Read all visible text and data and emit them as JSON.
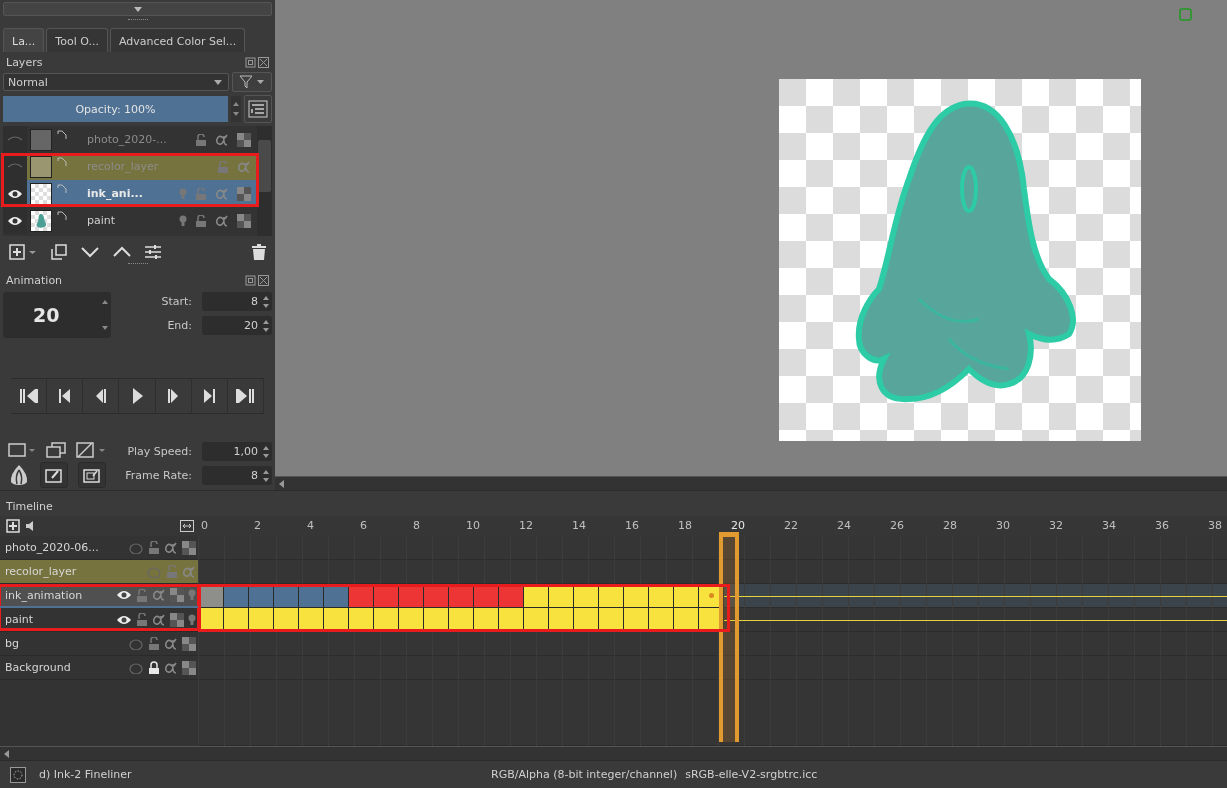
{
  "tabs": [
    {
      "label": "La...",
      "selected": true
    },
    {
      "label": "Tool O...",
      "selected": false
    },
    {
      "label": "Advanced Color Sel...",
      "selected": false
    }
  ],
  "layers_panel": {
    "title": "Layers",
    "blend_mode": "Normal",
    "opacity": {
      "label": "Opacity:  100%",
      "level": 1
    },
    "layers": [
      {
        "name": "photo_2020-...",
        "kind": "photo",
        "visible": false,
        "selected": false,
        "onion_skin": false,
        "annotated": false
      },
      {
        "name": "recolor_layer",
        "kind": "fill",
        "visible": false,
        "selected": false,
        "onion_skin": false,
        "annotated": true,
        "color": "#77733f"
      },
      {
        "name": "ink_ani...",
        "kind": "transparent",
        "visible": true,
        "selected": true,
        "onion_skin": true,
        "annotated": true
      },
      {
        "name": "paint",
        "kind": "figure",
        "visible": true,
        "selected": false,
        "onion_skin": true,
        "annotated": false
      }
    ]
  },
  "animation": {
    "title": "Animation",
    "current_frame": "20",
    "start_label": "Start:",
    "start": "8",
    "end_label": "End:",
    "end": "20",
    "play_speed_label": "Play Speed:",
    "play_speed": "1,00",
    "frame_rate_label": "Frame Rate:",
    "frame_rate": "8"
  },
  "timeline": {
    "title": "Timeline",
    "ruler": [
      {
        "label": "0",
        "selected": false
      },
      {
        "label": "2",
        "selected": false
      },
      {
        "label": "4",
        "selected": false
      },
      {
        "label": "6",
        "selected": false
      },
      {
        "label": "8",
        "selected": false
      },
      {
        "label": "10",
        "selected": false
      },
      {
        "label": "12",
        "selected": false
      },
      {
        "label": "14",
        "selected": false
      },
      {
        "label": "16",
        "selected": false
      },
      {
        "label": "18",
        "selected": false
      },
      {
        "label": "20",
        "selected": true
      },
      {
        "label": "22",
        "selected": false
      },
      {
        "label": "24",
        "selected": false
      },
      {
        "label": "26",
        "selected": false
      },
      {
        "label": "28",
        "selected": false
      },
      {
        "label": "30",
        "selected": false
      },
      {
        "label": "32",
        "selected": false
      },
      {
        "label": "34",
        "selected": false
      },
      {
        "label": "36",
        "selected": false
      },
      {
        "label": "38",
        "selected": false
      }
    ],
    "rows": [
      {
        "name": "photo_2020-06...",
        "visible": false,
        "locked": false,
        "onion_skin": false,
        "selected": false,
        "annotated": false,
        "frames": []
      },
      {
        "name": "recolor_layer",
        "visible": false,
        "locked": false,
        "onion_skin": false,
        "selected": false,
        "annotated": false,
        "color": "#77733f",
        "frames": []
      },
      {
        "name": "ink_animation",
        "visible": true,
        "locked": false,
        "onion_skin": true,
        "selected": true,
        "annotated": true,
        "frames": [
          {
            "color": "#8e8e8a",
            "selected": false
          },
          {
            "color": "#4f7194",
            "selected": false
          },
          {
            "color": "#4f7194",
            "selected": false
          },
          {
            "color": "#4f7194",
            "selected": false
          },
          {
            "color": "#4f7194",
            "selected": false
          },
          {
            "color": "#4f7194",
            "selected": false
          },
          {
            "color": "#ee3535",
            "selected": false
          },
          {
            "color": "#ee3535",
            "selected": false
          },
          {
            "color": "#ee3535",
            "selected": false
          },
          {
            "color": "#ee3535",
            "selected": false
          },
          {
            "color": "#ee3535",
            "selected": false
          },
          {
            "color": "#ee3535",
            "selected": false
          },
          {
            "color": "#ee3535",
            "selected": false
          },
          {
            "color": "#f7e23e",
            "selected": false
          },
          {
            "color": "#f7e23e",
            "selected": false
          },
          {
            "color": "#f7e23e",
            "selected": false
          },
          {
            "color": "#f7e23e",
            "selected": false
          },
          {
            "color": "#f7e23e",
            "selected": false
          },
          {
            "color": "#f7e23e",
            "selected": false
          },
          {
            "color": "#f7e23e",
            "selected": false
          },
          {
            "color": "#f7e23e",
            "selected": true
          }
        ]
      },
      {
        "name": "paint",
        "visible": true,
        "locked": false,
        "onion_skin": true,
        "selected": false,
        "annotated": true,
        "frames": [
          {
            "color": "#f7e23e",
            "selected": false
          },
          {
            "color": "#f7e23e",
            "selected": false
          },
          {
            "color": "#f7e23e",
            "selected": false
          },
          {
            "color": "#f7e23e",
            "selected": false
          },
          {
            "color": "#f7e23e",
            "selected": false
          },
          {
            "color": "#f7e23e",
            "selected": false
          },
          {
            "color": "#f7e23e",
            "selected": false
          },
          {
            "color": "#f7e23e",
            "selected": false
          },
          {
            "color": "#f7e23e",
            "selected": false
          },
          {
            "color": "#f7e23e",
            "selected": false
          },
          {
            "color": "#f7e23e",
            "selected": false
          },
          {
            "color": "#f7e23e",
            "selected": false
          },
          {
            "color": "#f7e23e",
            "selected": false
          },
          {
            "color": "#f7e23e",
            "selected": false
          },
          {
            "color": "#f7e23e",
            "selected": false
          },
          {
            "color": "#f7e23e",
            "selected": false
          },
          {
            "color": "#f7e23e",
            "selected": false
          },
          {
            "color": "#f7e23e",
            "selected": false
          },
          {
            "color": "#f7e23e",
            "selected": false
          },
          {
            "color": "#f7e23e",
            "selected": false
          },
          {
            "color": "#f7e23e",
            "selected": false
          }
        ]
      },
      {
        "name": "bg",
        "visible": false,
        "locked": false,
        "onion_skin": false,
        "selected": false,
        "annotated": false,
        "frames": []
      },
      {
        "name": "Background",
        "visible": false,
        "locked": true,
        "onion_skin": false,
        "selected": false,
        "annotated": false,
        "frames": []
      }
    ]
  },
  "status_bar": {
    "brush": "d) Ink-2 Fineliner",
    "color_space": "RGB/Alpha (8-bit integer/channel)",
    "profile": "sRGB-elle-V2-srgbtrc.icc"
  }
}
